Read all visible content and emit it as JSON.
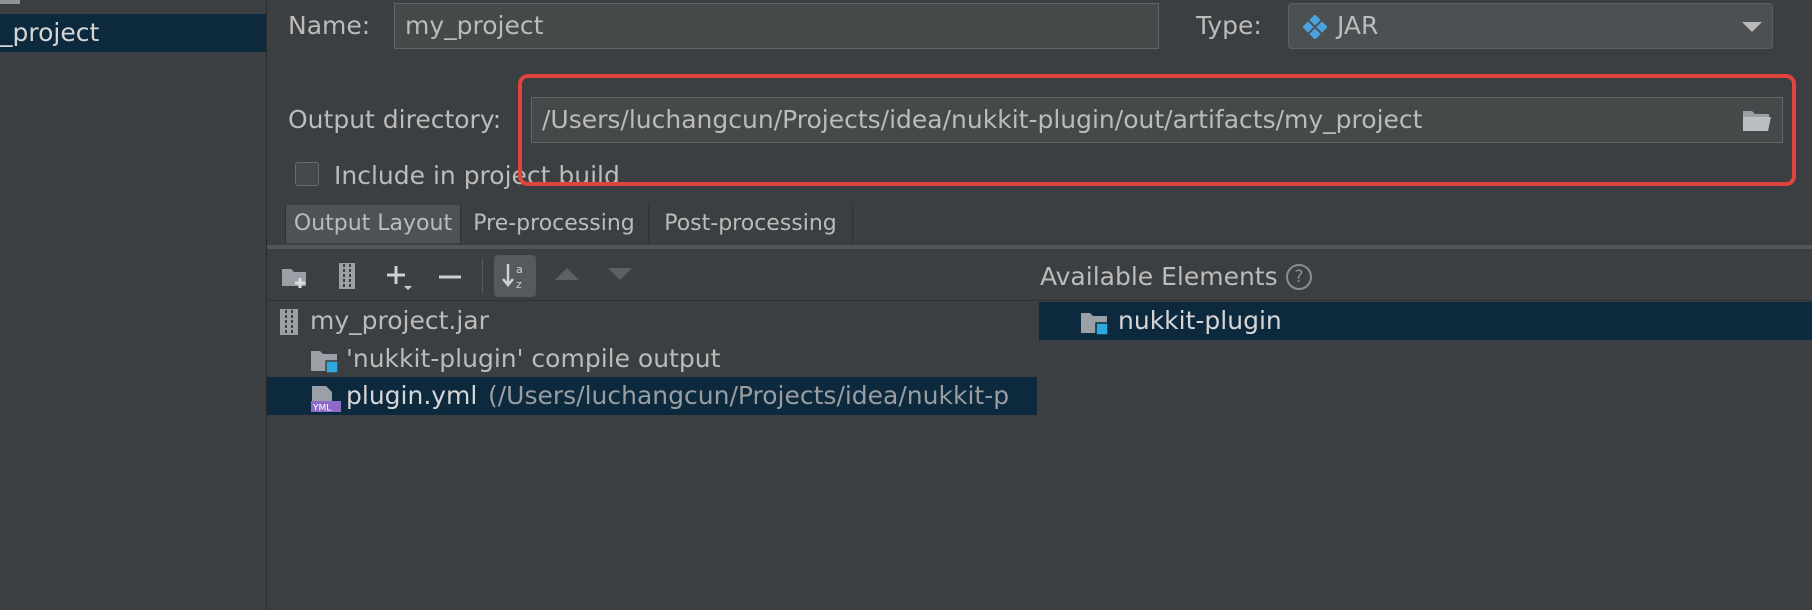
{
  "left_pane": {
    "selected_item": "_project"
  },
  "form": {
    "name_label": "Name:",
    "name_value": "my_project",
    "type_label": "Type:",
    "type_value": "JAR",
    "output_label": "Output directory:",
    "output_value": "/Users/luchangcun/Projects/idea/nukkit-plugin/out/artifacts/my_project",
    "include_label": "Include in project build",
    "include_checked": false
  },
  "tabs": [
    {
      "label": "Output Layout",
      "active": true
    },
    {
      "label": "Pre-processing",
      "active": false
    },
    {
      "label": "Post-processing",
      "active": false
    }
  ],
  "toolbar": {
    "icons": [
      "create-directory-icon",
      "archive-icon",
      "add-icon",
      "remove-icon",
      "sort-alphabetically-icon",
      "move-up-icon",
      "move-down-icon"
    ]
  },
  "output_tree": {
    "root": "my_project.jar",
    "items": [
      {
        "label": "'nukkit-plugin' compile output",
        "detail": ""
      },
      {
        "label": "plugin.yml",
        "detail": "(/Users/luchangcun/Projects/idea/nukkit-p"
      }
    ]
  },
  "available": {
    "title": "Available Elements",
    "help": "?",
    "items": [
      "nukkit-plugin"
    ]
  },
  "colors": {
    "background": "#3c3f41",
    "selection": "#0d293e",
    "highlight_border": "#e0443e",
    "accent_blue": "#4aa3df"
  }
}
